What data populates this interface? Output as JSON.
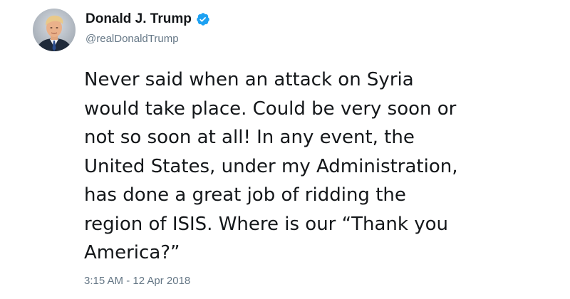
{
  "author": {
    "display_name": "Donald J. Trump",
    "handle": "@realDonaldTrump",
    "verified": true
  },
  "tweet": {
    "text": "Never said when an attack on Syria\nwould take place. Could be very soon or\nnot so soon at all! In any event, the\nUnited States, under my Administration,\nhas done a great job of ridding the\nregion of ISIS. Where is our “Thank you\nAmerica?”",
    "timestamp": "3:15 AM - 12 Apr 2018"
  },
  "icons": {
    "avatar": "profile-photo",
    "verified": "verified-badge-icon"
  },
  "colors": {
    "text": "#14171a",
    "secondary_text": "#657786",
    "verified_blue": "#1da1f2",
    "background": "#ffffff"
  }
}
